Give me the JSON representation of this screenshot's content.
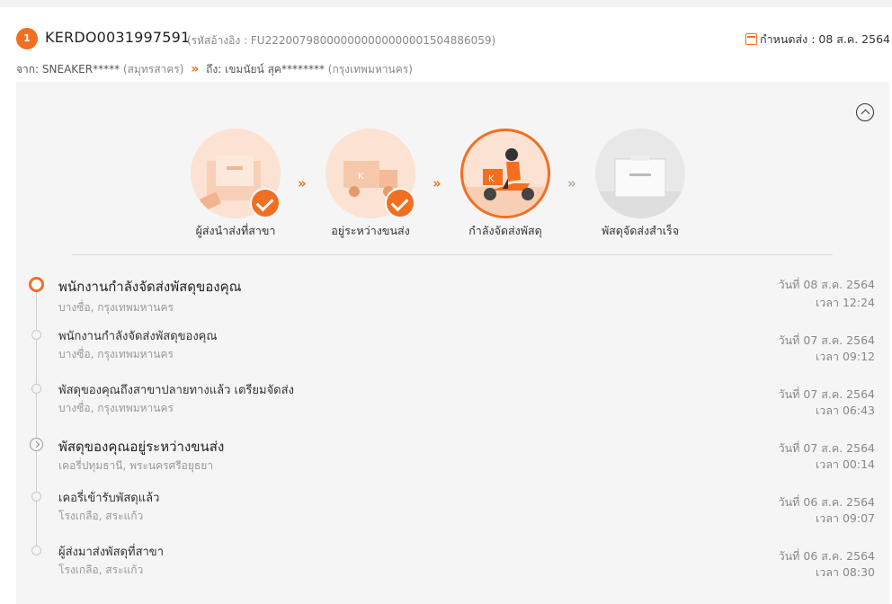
{
  "shipment": {
    "index": "1",
    "tracking_number": "KERDO0031997591",
    "reference": "(รหัสอ้างอิง : FU222007980000000000000001504886059)",
    "due_date": "กำหนดส่ง : 08 ส.ค. 2564"
  },
  "route": {
    "from_prefix": "จาก:",
    "from_name": "SNEAKER*****",
    "from_location": "(สมุทรสาคร)",
    "arrow": "»",
    "to_prefix": "ถึง:",
    "to_name": "เขมนัยน์ สุค********",
    "to_location": "(กรุงเทพมหานคร)"
  },
  "steps": [
    {
      "label": "ผู้ส่งนำส่งที่สาขา",
      "status": "done",
      "icon": "parcel-drop-icon"
    },
    {
      "label": "อยู่ระหว่างขนส่ง",
      "status": "done",
      "icon": "truck-icon"
    },
    {
      "label": "กำลังจัดส่งพัสดุ",
      "status": "current",
      "icon": "delivery-scooter-icon"
    },
    {
      "label": "พัสดุจัดส่งสำเร็จ",
      "status": "todo",
      "icon": "delivered-box-icon"
    }
  ],
  "step_arrow": "»",
  "timeline": [
    {
      "title": "พนักงานกำลังจัดส่งพัสดุของคุณ",
      "location": "บางซื่อ, กรุงเทพมหานคร",
      "date": "วันที่ 08 ส.ค. 2564",
      "time": "เวลา 12:24"
    },
    {
      "title": "พนักงานกำลังจัดส่งพัสดุของคุณ",
      "location": "บางซื่อ, กรุงเทพมหานคร",
      "date": "วันที่ 07 ส.ค. 2564",
      "time": "เวลา 09:12"
    },
    {
      "title": "พัสดุของคุณถึงสาขาปลายทางแล้ว เตรียมจัดส่ง",
      "location": "บางซื่อ, กรุงเทพมหานคร",
      "date": "วันที่ 07 ส.ค. 2564",
      "time": "เวลา 06:43"
    },
    {
      "title": "พัสดุของคุณอยู่ระหว่างขนส่ง",
      "location": "เคอรี่ปทุมธานี, พระนครศรีอยุธยา",
      "date": "วันที่ 07 ส.ค. 2564",
      "time": "เวลา 00:14"
    },
    {
      "title": "เคอรี่เข้ารับพัสดุแล้ว",
      "location": "โรงเกลือ, สระแก้ว",
      "date": "วันที่ 06 ส.ค. 2564",
      "time": "เวลา 09:07"
    },
    {
      "title": "ผู้ส่งมาส่งพัสดุที่สาขา",
      "location": "โรงเกลือ, สระแก้ว",
      "date": "วันที่ 06 ส.ค. 2564",
      "time": "เวลา 08:30"
    }
  ],
  "colors": {
    "accent": "#f26f21",
    "panel": "#f5f5f5",
    "muted": "#888888"
  }
}
